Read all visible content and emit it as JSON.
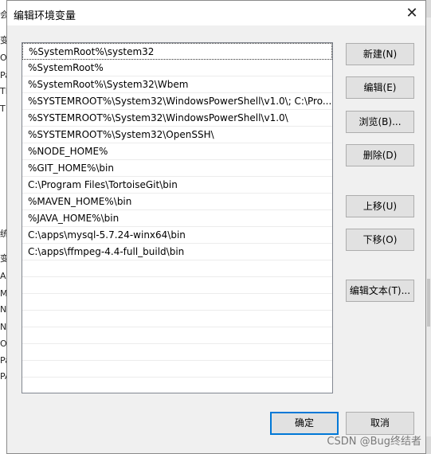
{
  "background": {
    "left_fragments": [
      "会",
      "变",
      "O",
      "Pa",
      "TE",
      "T",
      "统",
      "变",
      "A",
      "M",
      "N",
      "N",
      "O",
      "Pa",
      "PA"
    ]
  },
  "dialog": {
    "title": "编辑环境变量",
    "close_glyph": "✕"
  },
  "paths": [
    "%SystemRoot%\\system32",
    "%SystemRoot%",
    "%SystemRoot%\\System32\\Wbem",
    "%SYSTEMROOT%\\System32\\WindowsPowerShell\\v1.0\\;  C:\\Pro...",
    "%SYSTEMROOT%\\System32\\WindowsPowerShell\\v1.0\\",
    "%SYSTEMROOT%\\System32\\OpenSSH\\",
    "%NODE_HOME%",
    "%GIT_HOME%\\bin",
    "C:\\Program Files\\TortoiseGit\\bin",
    "%MAVEN_HOME%\\bin",
    "%JAVA_HOME%\\bin",
    "C:\\apps\\mysql-5.7.24-winx64\\bin",
    "C:\\apps\\ffmpeg-4.4-full_build\\bin"
  ],
  "empty_row_count": 8,
  "buttons": {
    "new": "新建(N)",
    "edit": "编辑(E)",
    "browse": "浏览(B)...",
    "delete": "删除(D)",
    "move_up": "上移(U)",
    "move_down": "下移(O)",
    "edit_text": "编辑文本(T)...",
    "ok": "确定",
    "cancel": "取消"
  },
  "watermark": "CSDN @Bug终结者"
}
